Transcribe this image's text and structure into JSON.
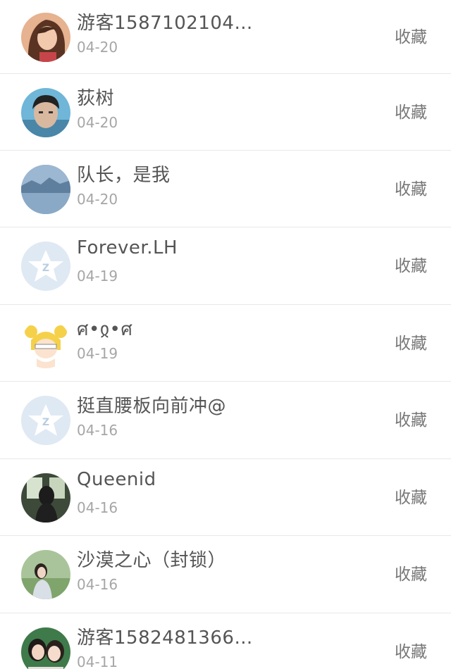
{
  "follow_list": {
    "items": [
      {
        "name": "游客1587102104…",
        "date": "04-20",
        "action": "收藏",
        "avatar": "photo-girl-avatar"
      },
      {
        "name": "荻树",
        "date": "04-20",
        "action": "收藏",
        "avatar": "photo-boy-avatar"
      },
      {
        "name": "队长，是我",
        "date": "04-20",
        "action": "收藏",
        "avatar": "photo-landscape-avatar"
      },
      {
        "name": "Forever.LH",
        "date": "04-19",
        "action": "收藏",
        "avatar": "default-star-avatar"
      },
      {
        "name": "ศ•ჲ•ศ",
        "date": "04-19",
        "action": "收藏",
        "avatar": "cartoon-sailor-avatar"
      },
      {
        "name": "挺直腰板向前冲@",
        "date": "04-16",
        "action": "收藏",
        "avatar": "default-star-avatar"
      },
      {
        "name": "Queenid",
        "date": "04-16",
        "action": "收藏",
        "avatar": "photo-woman-dark-avatar"
      },
      {
        "name": "沙漠之心（封锁）",
        "date": "04-16",
        "action": "收藏",
        "avatar": "photo-woman-garden-avatar"
      },
      {
        "name": "游客1582481366…",
        "date": "04-11",
        "action": "收藏",
        "avatar": "photo-two-girls-avatar"
      }
    ]
  }
}
